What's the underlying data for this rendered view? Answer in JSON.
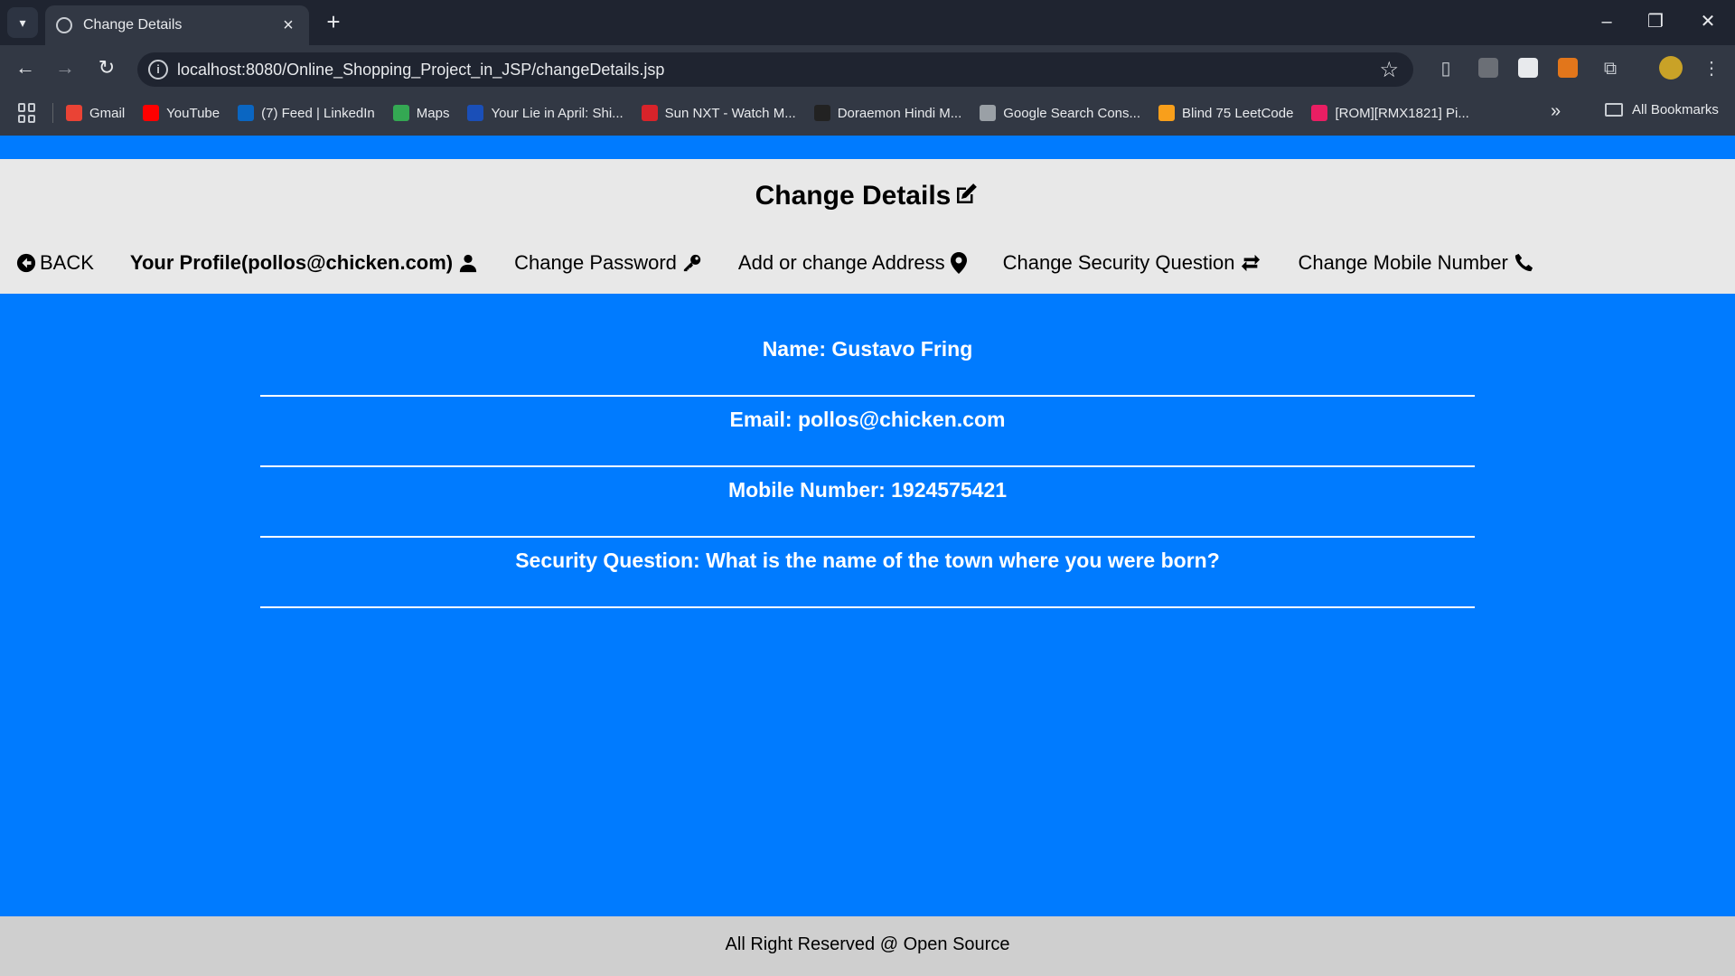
{
  "browser": {
    "tab_title": "Change Details",
    "url": "localhost:8080/Online_Shopping_Project_in_JSP/changeDetails.jsp",
    "bookmarks": [
      {
        "label": "Gmail",
        "icon": "gmail-icon",
        "color": "#ea4335"
      },
      {
        "label": "YouTube",
        "icon": "youtube-icon",
        "color": "#ff0000"
      },
      {
        "label": "(7) Feed | LinkedIn",
        "icon": "linkedin-icon",
        "color": "#0a66c2"
      },
      {
        "label": "Maps",
        "icon": "maps-icon",
        "color": "#34a853"
      },
      {
        "label": "Your Lie in April: Shi...",
        "icon": "site-icon",
        "color": "#1a4fb8"
      },
      {
        "label": "Sun NXT - Watch M...",
        "icon": "sunnxt-icon",
        "color": "#d8232a"
      },
      {
        "label": "Doraemon Hindi M...",
        "icon": "site-icon",
        "color": "#222222"
      },
      {
        "label": "Google Search Cons...",
        "icon": "search-console-icon",
        "color": "#9aa0a6"
      },
      {
        "label": "Blind 75 LeetCode",
        "icon": "leetcode-icon",
        "color": "#f89f1b"
      },
      {
        "label": "[ROM][RMX1821] Pi...",
        "icon": "xda-icon",
        "color": "#e91e63"
      }
    ],
    "all_bookmarks": "All Bookmarks"
  },
  "page": {
    "title": "Change Details",
    "nav": {
      "back": "BACK",
      "profile": "Your Profile(pollos@chicken.com)",
      "change_password": "Change Password",
      "change_address": "Add or change Address",
      "change_security": "Change Security Question",
      "change_mobile": "Change Mobile Number"
    },
    "details": [
      "Name: Gustavo Fring",
      "Email: pollos@chicken.com",
      "Mobile Number: 1924575421",
      "Security Question: What is the name of the town where you were born?"
    ],
    "footer": "All Right Reserved @ Open Source"
  },
  "colors": {
    "page_blue": "#007bff",
    "header_gray": "#e8e8e8",
    "footer_gray": "#cfcfcf"
  }
}
